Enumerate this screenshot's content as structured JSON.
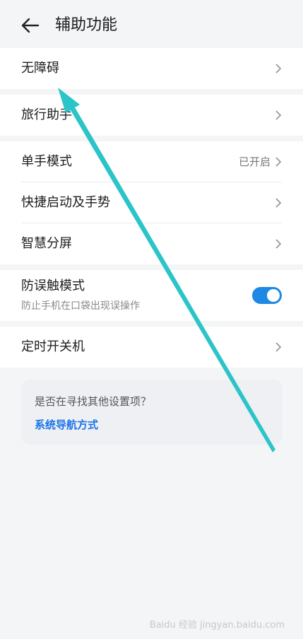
{
  "header": {
    "title": "辅助功能",
    "back_icon": "back-arrow-icon"
  },
  "groups": [
    {
      "items": [
        {
          "label": "无障碍"
        }
      ]
    },
    {
      "items": [
        {
          "label": "旅行助手"
        }
      ]
    },
    {
      "items": [
        {
          "label": "单手模式",
          "status": "已开启"
        },
        {
          "label": "快捷启动及手势"
        },
        {
          "label": "智慧分屏"
        }
      ]
    },
    {
      "items": [
        {
          "label": "防误触模式",
          "subtitle": "防止手机在口袋出现误操作",
          "toggle_on": true
        }
      ]
    },
    {
      "items": [
        {
          "label": "定时开关机"
        }
      ]
    }
  ],
  "suggestion": {
    "question": "是否在寻找其他设置项？",
    "link": "系统导航方式"
  },
  "watermark": "Baidu 经验 jingyan.baidu.com",
  "colors": {
    "accent": "#1e88e5",
    "annotation_arrow": "#2bc4c9"
  }
}
